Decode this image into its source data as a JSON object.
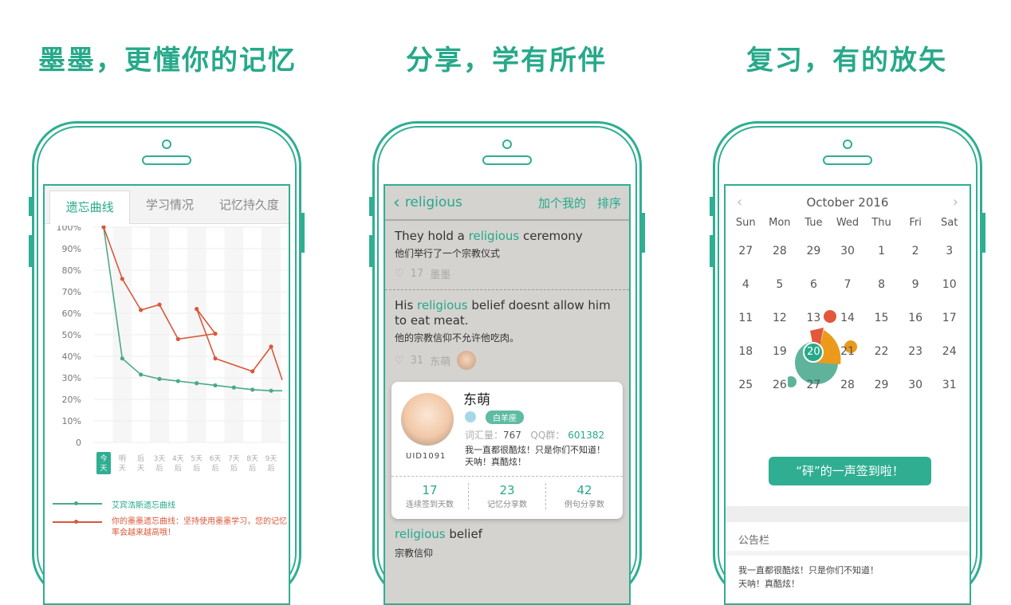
{
  "headlines": [
    "墨墨，更懂你的记忆",
    "分享，学有所伴",
    "复习，有的放矢"
  ],
  "colors": {
    "brand": "#2fae92",
    "text_accent": "#26a98a",
    "orange_curve": "#d9583a",
    "pie_orange": "#eb9a1c"
  },
  "phone1": {
    "tabs": [
      {
        "label": "遗忘曲线",
        "active": true
      },
      {
        "label": "学习情况",
        "active": false
      },
      {
        "label": "记忆持久度",
        "active": false
      }
    ],
    "legend": {
      "ebbinghaus": "艾宾浩斯遗忘曲线",
      "mine": "你的墨墨遗忘曲线：坚持使用墨墨学习，您的记忆率会越来越高哦！"
    }
  },
  "chart_data": {
    "type": "line",
    "title": "遗忘曲线",
    "categories": [
      "今天",
      "明天",
      "后天",
      "3天后",
      "4天后",
      "5天后",
      "6天后",
      "7天后",
      "8天后",
      "9天后"
    ],
    "y_ticks": [
      "0",
      "10%",
      "20%",
      "30%",
      "40%",
      "50%",
      "60%",
      "70%",
      "80%",
      "90%",
      "100%"
    ],
    "ylim": [
      0,
      100
    ],
    "grid": true,
    "series": [
      {
        "name": "艾宾浩斯遗忘曲线",
        "color": "#4aa98a",
        "points": [
          [
            0,
            100
          ],
          [
            1,
            39
          ],
          [
            2,
            31.5
          ],
          [
            3,
            29.5
          ],
          [
            4,
            28.5
          ],
          [
            5,
            27.5
          ],
          [
            6,
            26.5
          ],
          [
            7,
            25.5
          ],
          [
            8,
            24.5
          ],
          [
            9,
            24
          ],
          [
            9.6,
            24
          ]
        ]
      },
      {
        "name": "你的墨墨遗忘曲线",
        "color": "#d9583a",
        "points": [
          [
            0,
            100
          ],
          [
            1,
            76
          ],
          [
            2,
            61.5
          ],
          [
            3,
            64
          ],
          [
            4,
            48
          ],
          [
            6,
            50.5
          ],
          [
            5,
            62
          ],
          [
            6,
            39
          ],
          [
            8,
            33
          ],
          [
            9,
            44.5
          ],
          [
            9.6,
            29
          ]
        ]
      }
    ],
    "legend": "bottom"
  },
  "phone2": {
    "nav": {
      "back_icon": "chevron-left",
      "word": "religious",
      "add_mine": "加个我的",
      "sort": "排序"
    },
    "sentences": [
      {
        "pre": "They hold a ",
        "hl": "religious",
        "post": " ceremony",
        "zh": "他们举行了一个宗教仪式",
        "likes": "17",
        "author": "墨墨"
      },
      {
        "pre": "His ",
        "hl": "religious",
        "post": " belief doesnt allow him to eat meat.",
        "zh": "他的宗教信仰不允许他吃肉。",
        "likes": "31",
        "author": "东萌"
      }
    ],
    "profile": {
      "name": "东萌",
      "uid": "UID1091",
      "constellation": "白羊座",
      "vocab_label": "词汇量：",
      "vocab": "767",
      "qq_label": "QQ群：",
      "qq": "601382",
      "bio_line1": "我一直都很酷炫！只是你们不知道！",
      "bio_line2": "天呐！真酷炫！",
      "stats": [
        {
          "value": "17",
          "label": "连续签到天数"
        },
        {
          "value": "23",
          "label": "记忆分享数"
        },
        {
          "value": "42",
          "label": "例句分享数"
        }
      ]
    },
    "bottom": {
      "hl": "religious",
      "post": " belief",
      "zh": "宗教信仰"
    }
  },
  "phone3": {
    "month_title": "October 2016",
    "weekdays": [
      "Sun",
      "Mon",
      "Tue",
      "Wed",
      "Thu",
      "Fri",
      "Sat"
    ],
    "days": [
      {
        "d": "27",
        "done": false
      },
      {
        "d": "28",
        "done": true
      },
      {
        "d": "29",
        "done": false
      },
      {
        "d": "30",
        "done": false
      },
      {
        "d": "1",
        "done": true
      },
      {
        "d": "2",
        "done": true
      },
      {
        "d": "3",
        "done": false
      },
      {
        "d": "4",
        "done": true
      },
      {
        "d": "5",
        "done": true
      },
      {
        "d": "6",
        "done": true
      },
      {
        "d": "7",
        "done": true
      },
      {
        "d": "8",
        "done": false
      },
      {
        "d": "9",
        "done": false
      },
      {
        "d": "10",
        "done": false
      },
      {
        "d": "11",
        "done": false
      },
      {
        "d": "12",
        "done": false
      },
      {
        "d": "13",
        "done": false
      },
      {
        "d": "14",
        "done": false
      },
      {
        "d": "15",
        "done": true
      },
      {
        "d": "16",
        "done": true
      },
      {
        "d": "17",
        "done": true
      },
      {
        "d": "18",
        "done": false
      },
      {
        "d": "19",
        "done": false
      },
      {
        "d": "20",
        "done": false,
        "today": true
      },
      {
        "d": "21",
        "done": false
      },
      {
        "d": "22",
        "done": false
      },
      {
        "d": "23",
        "done": false
      },
      {
        "d": "24",
        "done": false
      },
      {
        "d": "25",
        "done": false
      },
      {
        "d": "26",
        "done": false
      },
      {
        "d": "27",
        "done": false
      },
      {
        "d": "28",
        "done": false
      },
      {
        "d": "29",
        "done": false
      },
      {
        "d": "30",
        "done": false
      },
      {
        "d": "31",
        "done": false
      }
    ],
    "checkin_button": "“砰”的一声签到啦！",
    "board_title": "公告栏",
    "board_line1": "我一直都很酷炫！只是你们不知道！",
    "board_line2": "天呐！真酷炫！"
  }
}
